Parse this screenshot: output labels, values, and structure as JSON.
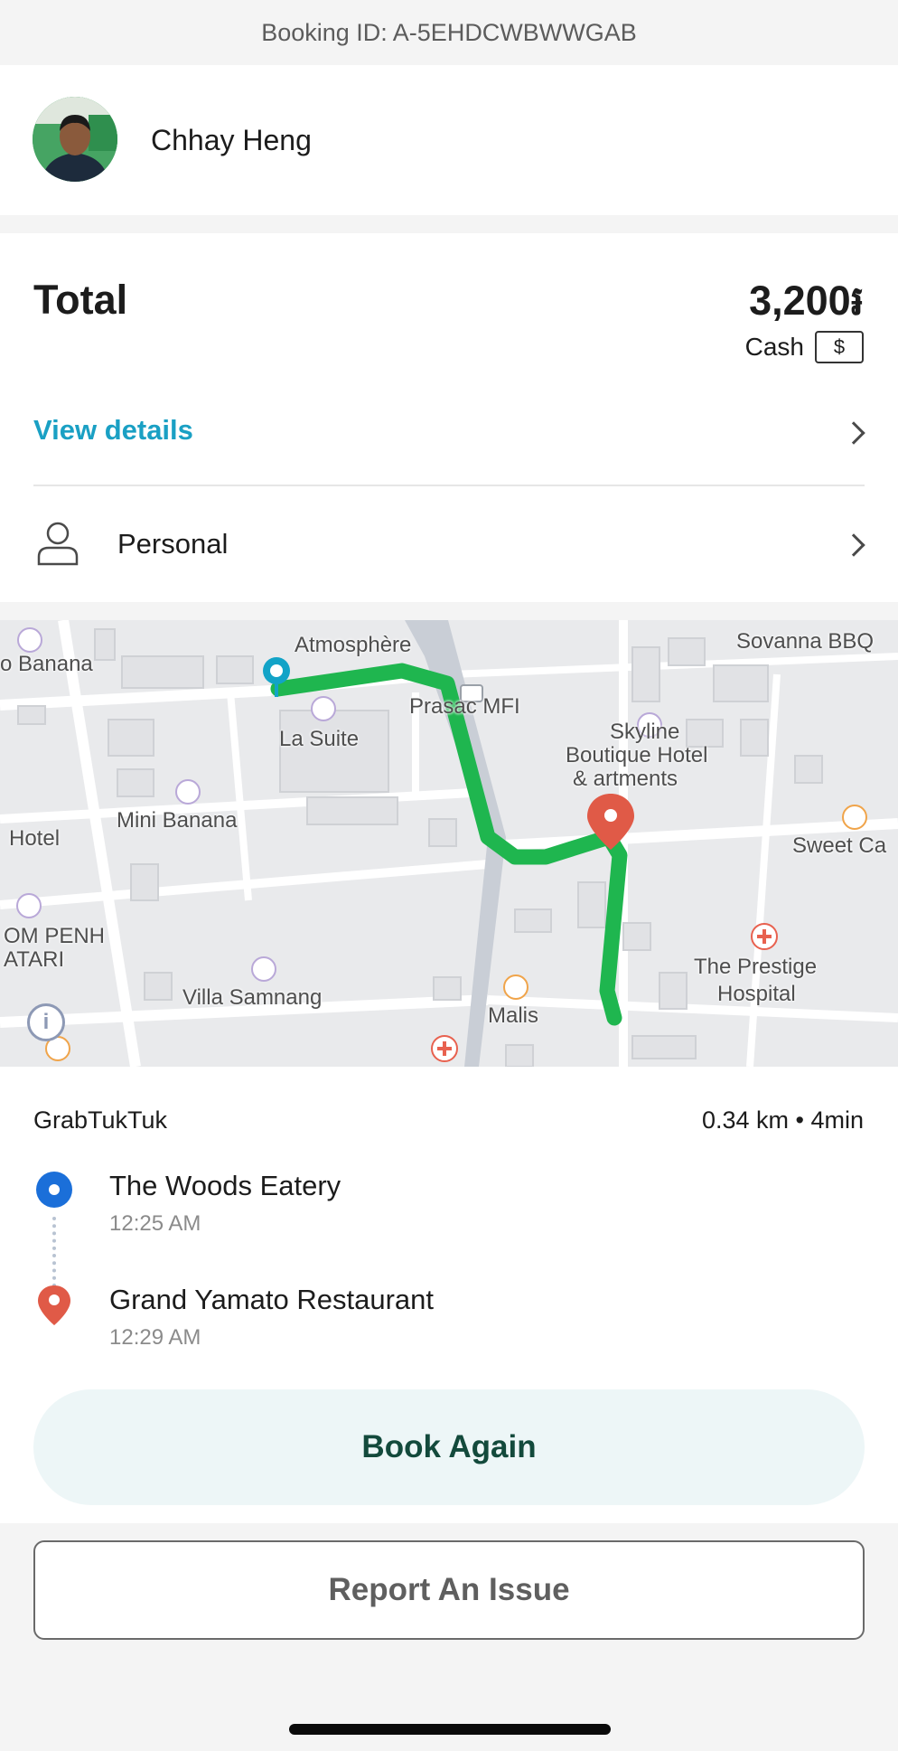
{
  "header": {
    "booking_id": "Booking ID: A-5EHDCWBWWGAB"
  },
  "driver": {
    "name": "Chhay Heng"
  },
  "payment": {
    "total_label": "Total",
    "total_amount": "3,200៛",
    "method": "Cash",
    "method_badge": "$",
    "view_details": "View details",
    "profile": "Personal"
  },
  "map": {
    "labels": {
      "atmosphere": "Atmosphère",
      "sovanna": "Sovanna BBQ",
      "banana": "o Banana",
      "prasac": "Prasac MFI",
      "la_suite": "La Suite",
      "skyline1": "Skyline",
      "skyline2": "Boutique Hotel",
      "skyline3": "&  artments",
      "mini_banana": "Mini Banana",
      "hotel": "Hotel",
      "sweet": "Sweet Ca",
      "om_penh": "OM PENH",
      "katari": "ATARI",
      "villa": "Villa Samnang",
      "malis": "Malis",
      "prestige1": "The Prestige",
      "prestige2": "Hospital"
    },
    "colors": {
      "route": "#1fb64f",
      "pickup": "#12a3c7",
      "dropoff": "#e05a47"
    }
  },
  "trip": {
    "vehicle": "GrabTukTuk",
    "distance_time": "0.34 km • 4min",
    "pickup": {
      "name": "The Woods Eatery",
      "time": "12:25 AM"
    },
    "dropoff": {
      "name": "Grand Yamato Restaurant",
      "time": "12:29 AM"
    }
  },
  "actions": {
    "book_again": "Book Again",
    "report": "Report An Issue"
  }
}
